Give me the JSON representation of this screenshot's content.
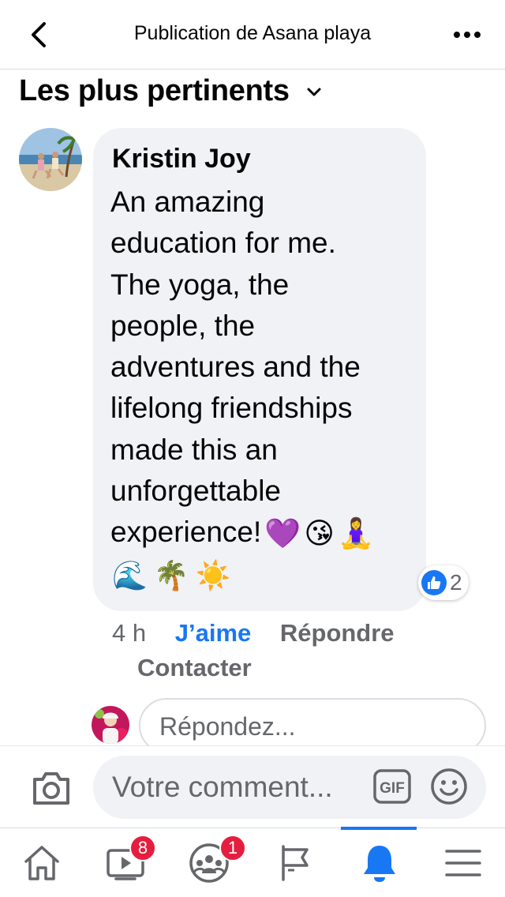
{
  "header": {
    "title": "Publication de Asana playa"
  },
  "sort": {
    "label": "Les plus pertinents"
  },
  "comment": {
    "author": "Kristin Joy",
    "text": "An amazing\neducation for me.\nThe yoga, the\npeople, the\nadventures and the\nlifelong friendships\nmade this an\nunforgettable\nexperience!",
    "emojis_inline": [
      "💜",
      "😘",
      "🧘‍♀️"
    ],
    "emojis_line2": [
      "🌊",
      "🌴",
      "☀️"
    ],
    "reactions": {
      "type": "like",
      "count": "2"
    },
    "timestamp": "4 h",
    "actions": {
      "like": "J’aime",
      "reply": "Répondre",
      "contact": "Contacter"
    }
  },
  "reply_input": {
    "placeholder": "Répondez..."
  },
  "composer": {
    "placeholder": "Votre comment...",
    "gif_label": "GIF"
  },
  "tabbar": {
    "tabs": [
      {
        "name": "home",
        "icon": "home-icon",
        "badge": ""
      },
      {
        "name": "watch",
        "icon": "video-icon",
        "badge": "8"
      },
      {
        "name": "groups",
        "icon": "groups-icon",
        "badge": "1"
      },
      {
        "name": "pages",
        "icon": "flag-icon",
        "badge": ""
      },
      {
        "name": "notifications",
        "icon": "bell-icon",
        "badge": "",
        "active": true
      },
      {
        "name": "menu",
        "icon": "menu-icon",
        "badge": ""
      }
    ]
  },
  "colors": {
    "accent": "#1877f2",
    "badge": "#e41e3f",
    "bubble": "#f0f2f5",
    "secondary_text": "#65676b"
  }
}
